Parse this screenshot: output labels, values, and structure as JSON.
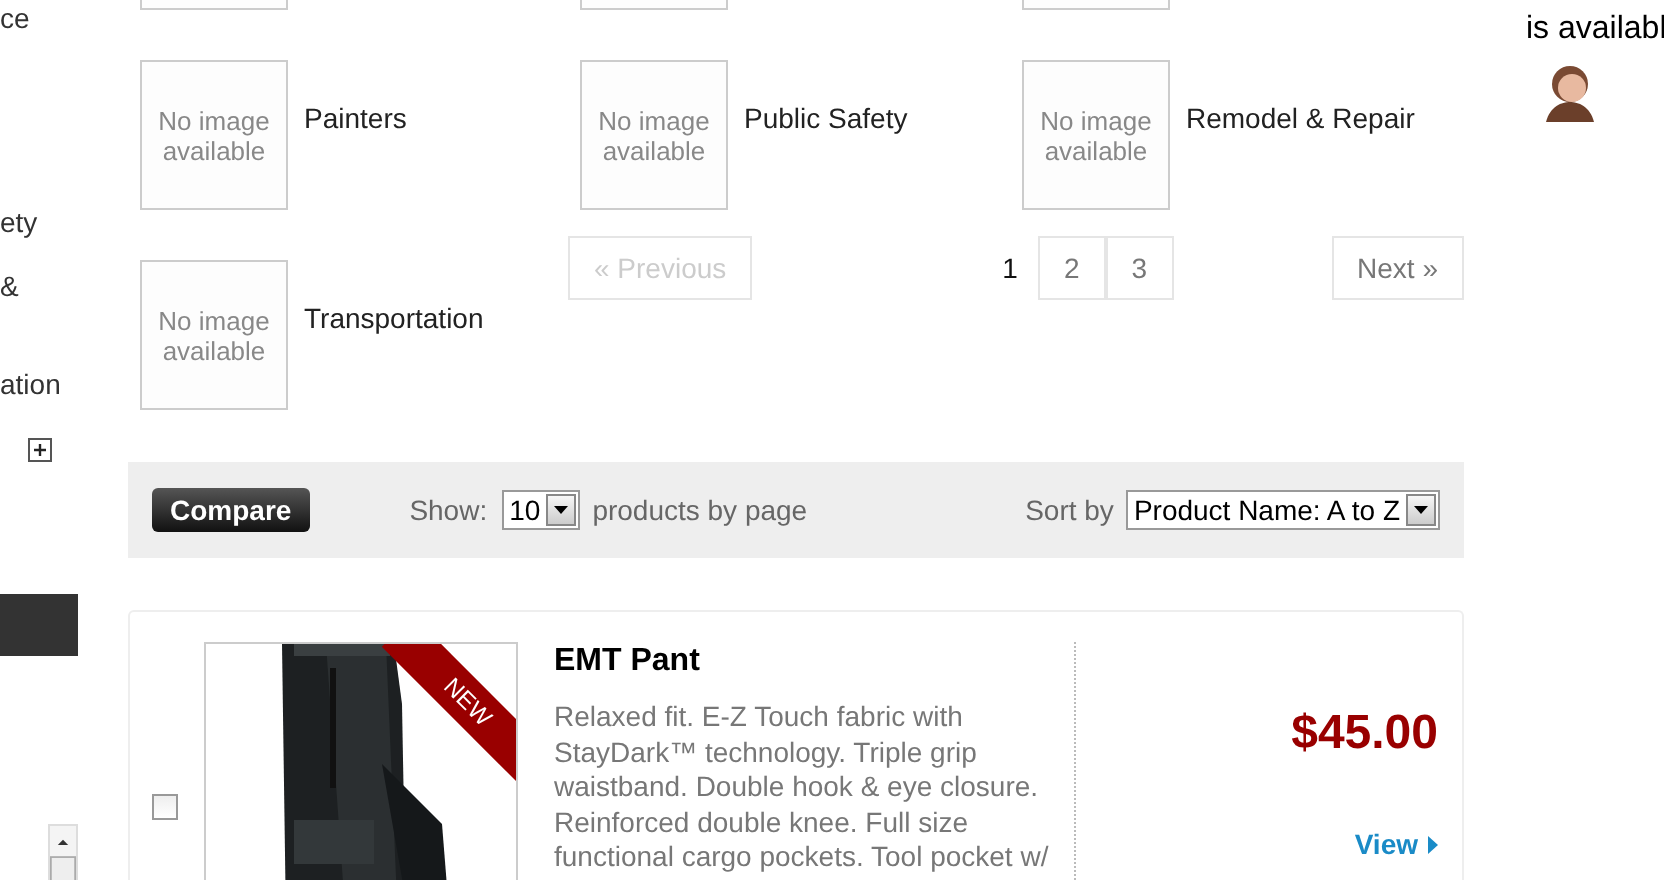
{
  "sidebar": {
    "items": [
      {
        "label": "ce"
      },
      {
        "label": "ety"
      },
      {
        "label": "&"
      },
      {
        "label": "ation"
      }
    ],
    "toggle": {
      "expanded": false
    }
  },
  "categories": [
    {
      "kind": "cut"
    },
    {
      "kind": "cut"
    },
    {
      "kind": "cut"
    },
    {
      "kind": "item",
      "name": "Painters",
      "image_text": "No image available"
    },
    {
      "kind": "item",
      "name": "Public Safety",
      "image_text": "No image available"
    },
    {
      "kind": "item",
      "name": "Remodel & Repair",
      "image_text": "No image available"
    },
    {
      "kind": "item",
      "name": "Transportation",
      "image_text": "No image available"
    }
  ],
  "pagination": {
    "previous": {
      "label": "« Previous",
      "disabled": true
    },
    "pages": [
      {
        "label": "1",
        "selected": true
      },
      {
        "label": "2",
        "selected": false
      },
      {
        "label": "3",
        "selected": false
      }
    ],
    "next": {
      "label": "Next »",
      "disabled": false
    }
  },
  "toolbar": {
    "compare": "Compare",
    "show_label": "Show:",
    "per_page": "10",
    "per_page_suffix": "products by page",
    "sort_label": "Sort by",
    "sort": "Product Name: A to Z"
  },
  "product": {
    "checked": false,
    "badge": "NEW",
    "title": "EMT Pant",
    "description": "Relaxed fit. E-Z Touch fabric with StayDark™ technology. Triple grip waistband. Double hook & eye closure. Reinforced double knee. Full size functional cargo pockets. Tool pocket w/",
    "price": "$45.00",
    "action": "View"
  },
  "chat": {
    "text": "is availabl"
  }
}
